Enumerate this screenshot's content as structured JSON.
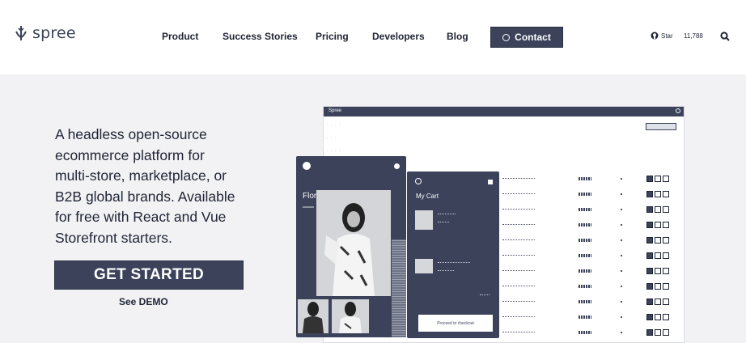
{
  "brand": {
    "name": "spree"
  },
  "nav": {
    "items": [
      "Product",
      "Success Stories",
      "Pricing",
      "Developers",
      "Blog"
    ],
    "contact": "Contact"
  },
  "github": {
    "label": "Star",
    "count": "11,788"
  },
  "hero": {
    "lines": [
      "A headless open-source",
      "ecommerce platform for",
      "multi-store, marketplace, or",
      "B2B global brands. Available",
      "for free with React and Vue",
      "Storefront starters."
    ],
    "cta": "GET STARTED",
    "demo": "See DEMO"
  },
  "mockup": {
    "admin_logo": "Spree",
    "product_title": "Floral Shirt",
    "cart_title": "My Cart",
    "checkout": "Proceed to checkout"
  },
  "colors": {
    "primary": "#3b425a",
    "background": "#f2f2f4",
    "header": "#ffffff"
  },
  "icons": [
    "spree-logo-icon",
    "contact-icon",
    "github-icon",
    "search-icon"
  ]
}
